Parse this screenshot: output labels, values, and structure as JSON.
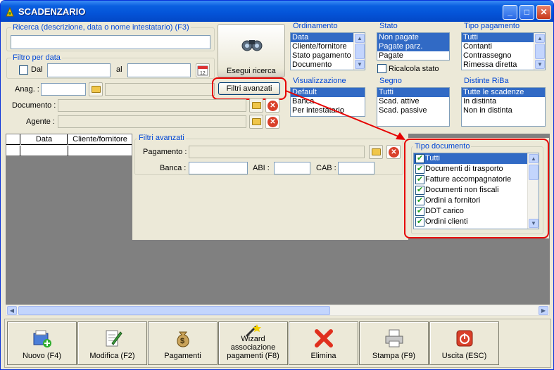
{
  "window": {
    "title": "SCADENZARIO"
  },
  "search": {
    "label": "Ricerca (descrizione, data o nome intestatario) (F3)",
    "value": "",
    "button": "Esegui ricerca"
  },
  "date_filter": {
    "label": "Filtro per data",
    "from_label": "Dal",
    "to_label": "al",
    "from_value": "",
    "to_value": ""
  },
  "anag": {
    "label": "Anag. :"
  },
  "advanced_button": "Filtri avanzati",
  "documento": {
    "label": "Documento :"
  },
  "agente": {
    "label": "Agente :"
  },
  "ordinamento": {
    "label": "Ordinamento",
    "items": [
      "Data",
      "Cliente/fornitore",
      "Stato pagamento",
      "Documento"
    ],
    "selected": 0
  },
  "stato": {
    "label": "Stato",
    "items": [
      "Non pagate",
      "Pagate parz.",
      "Pagate"
    ],
    "selected": [
      0,
      1
    ],
    "recalc": "Ricalcola stato"
  },
  "tipo_pagamento": {
    "label": "Tipo pagamento",
    "items": [
      "Tutti",
      "Contanti",
      "Contrassegno",
      "Rimessa diretta"
    ],
    "selected": 0
  },
  "visualizzazione": {
    "label": "Visualizzazione",
    "items": [
      "Default",
      "Banca",
      "Per intestatario"
    ],
    "selected": 0
  },
  "segno": {
    "label": "Segno",
    "items": [
      "Tutti",
      "Scad. attive",
      "Scad. passive"
    ],
    "selected": 0
  },
  "distinte": {
    "label": "Distinte RiBa",
    "items": [
      "Tutte le scadenze",
      "In distinta",
      "Non in distinta"
    ],
    "selected": 0
  },
  "grid": {
    "columns": [
      "Data",
      "Cliente/fornitore"
    ]
  },
  "advanced": {
    "label": "Filtri avanzati",
    "pagamento": "Pagamento :",
    "banca": "Banca :",
    "abi": "ABI :",
    "cab": "CAB :"
  },
  "tipo_documento": {
    "label": "Tipo documento",
    "items": [
      "Tutti",
      "Documenti di trasporto",
      "Fatture accompagnatorie",
      "Documenti non fiscali",
      "Ordini a fornitori",
      "DDT carico",
      "Ordini clienti"
    ],
    "selected": 0
  },
  "toolbar": {
    "nuovo": "Nuovo (F4)",
    "modifica": "Modifica (F2)",
    "pagamenti": "Pagamenti",
    "wizard_1": "Wizard",
    "wizard_2": "associazione",
    "wizard_3": "pagamenti (F8)",
    "elimina": "Elimina",
    "stampa": "Stampa (F9)",
    "uscita": "Uscita (ESC)"
  },
  "colors": {
    "titlebar": "#0454d8",
    "group_label": "#0046d5",
    "selection": "#316ac5",
    "highlight": "#e60000"
  }
}
